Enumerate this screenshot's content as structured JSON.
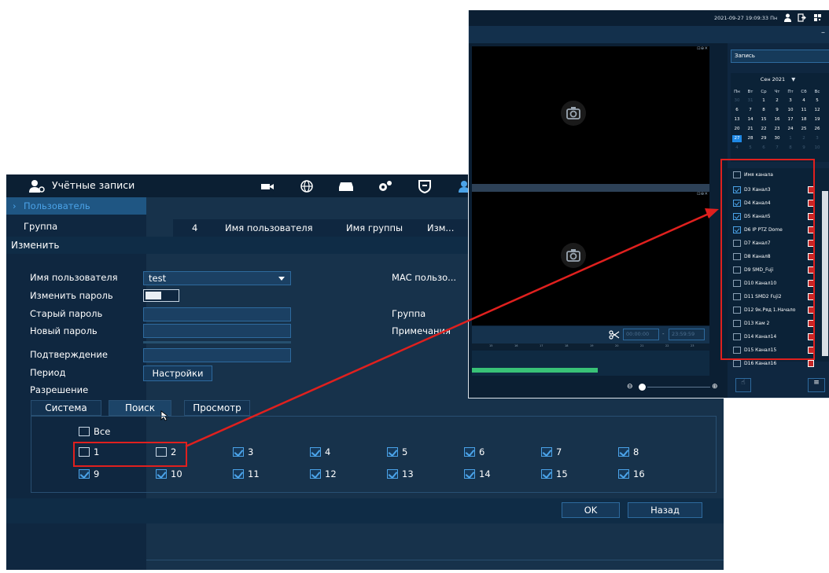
{
  "left_window": {
    "title": "Учётные записи",
    "sidebar": {
      "active_item": "Пользователь",
      "item2": "Группа"
    },
    "table_header": {
      "count": "4",
      "col_user": "Имя пользователя",
      "col_group": "Имя группы",
      "col_edit": "Изм..."
    },
    "dialog": {
      "header": "Изменить",
      "username_label": "Имя пользователя",
      "username_value": "test",
      "mac_label": "MAC пользо...",
      "change_pass_label": "Изменить пароль",
      "old_pass_label": "Старый пароль",
      "new_pass_label": "Новый пароль",
      "group_label": "Группа",
      "notes_label": "Примечания",
      "confirm_label": "Подтверждение",
      "period_label": "Период",
      "period_button": "Настройки",
      "permission_label": "Разрешение",
      "tabs": [
        "Система",
        "Поиск",
        "Просмотр"
      ],
      "all_label": "Все",
      "channels_row1": [
        "1",
        "2",
        "3",
        "4",
        "5",
        "6",
        "7",
        "8"
      ],
      "channels_row2": [
        "9",
        "10",
        "11",
        "12",
        "13",
        "14",
        "15",
        "16"
      ],
      "ok_button": "OK",
      "back_button": "Назад"
    }
  },
  "right_window": {
    "clock": "2021-09-27 19:09:33 Пн",
    "record_select": "Запись",
    "calendar": {
      "month": "Сен 2021",
      "weekdays": [
        "Пн",
        "Вт",
        "Ср",
        "Чт",
        "Пт",
        "Сб",
        "Вс"
      ],
      "weeks": [
        [
          "30",
          "31",
          "1",
          "2",
          "3",
          "4",
          "5"
        ],
        [
          "6",
          "7",
          "8",
          "9",
          "10",
          "11",
          "12"
        ],
        [
          "13",
          "14",
          "15",
          "16",
          "17",
          "18",
          "19"
        ],
        [
          "20",
          "21",
          "22",
          "23",
          "24",
          "25",
          "26"
        ],
        [
          "27",
          "28",
          "29",
          "30",
          "1",
          "2",
          "3"
        ],
        [
          "4",
          "5",
          "6",
          "7",
          "8",
          "9",
          "10"
        ]
      ],
      "selected_day": "27"
    },
    "channel_header": "Имя канала",
    "channels": [
      "D3 Канал3",
      "D4 Канал4",
      "D5 Канал5",
      "D6 IP PTZ Dome",
      "D7 Канал7",
      "D8 Канал8",
      "D9 SMD_Fuji",
      "D10 Канал10",
      "D11 SMD2 Fuji2",
      "D12 9к.Ряд 1.Начало",
      "D13 Кам 2",
      "D14 Канал14",
      "D15 Канал15",
      "D16 Канал16"
    ],
    "time_start": "00:00:00",
    "time_end": "23:59:59",
    "timeline_ticks": [
      "15",
      "16",
      "17",
      "18",
      "19",
      "20",
      "21",
      "22",
      "23"
    ]
  },
  "colors": {
    "highlight": "#e0201e",
    "accent": "#4ba3e8",
    "record_bar": "#39c277"
  }
}
